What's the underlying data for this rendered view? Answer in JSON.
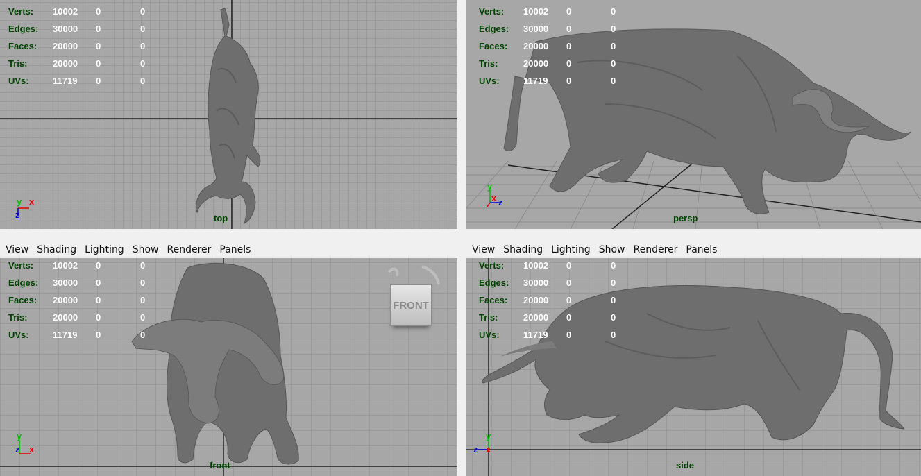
{
  "menu": [
    "View",
    "Shading",
    "Lighting",
    "Show",
    "Renderer",
    "Panels"
  ],
  "hud": {
    "rows": [
      {
        "label": "Verts:",
        "v1": "10002",
        "v2": "0",
        "v3": "0"
      },
      {
        "label": "Edges:",
        "v1": "30000",
        "v2": "0",
        "v3": "0"
      },
      {
        "label": "Faces:",
        "v1": "20000",
        "v2": "0",
        "v3": "0"
      },
      {
        "label": "Tris:",
        "v1": "20000",
        "v2": "0",
        "v3": "0"
      },
      {
        "label": "UVs:",
        "v1": "11719",
        "v2": "0",
        "v3": "0"
      }
    ]
  },
  "viewports": {
    "top": {
      "camera": "top"
    },
    "persp": {
      "camera": "persp"
    },
    "front": {
      "camera": "front",
      "viewcube_label": "FRONT"
    },
    "side": {
      "camera": "side"
    }
  },
  "axes": {
    "x": "x",
    "y": "y",
    "z": "z"
  },
  "colors": {
    "viewport_bg": "#a7a7a7",
    "grid": "#8c8c8c",
    "axis_line": "#222222",
    "hud_label": "#004400",
    "hud_value": "#ffffff",
    "x_axis": "#e00000",
    "y_axis": "#00c000",
    "z_axis": "#0000e0",
    "mesh": "#6e6e6e"
  }
}
